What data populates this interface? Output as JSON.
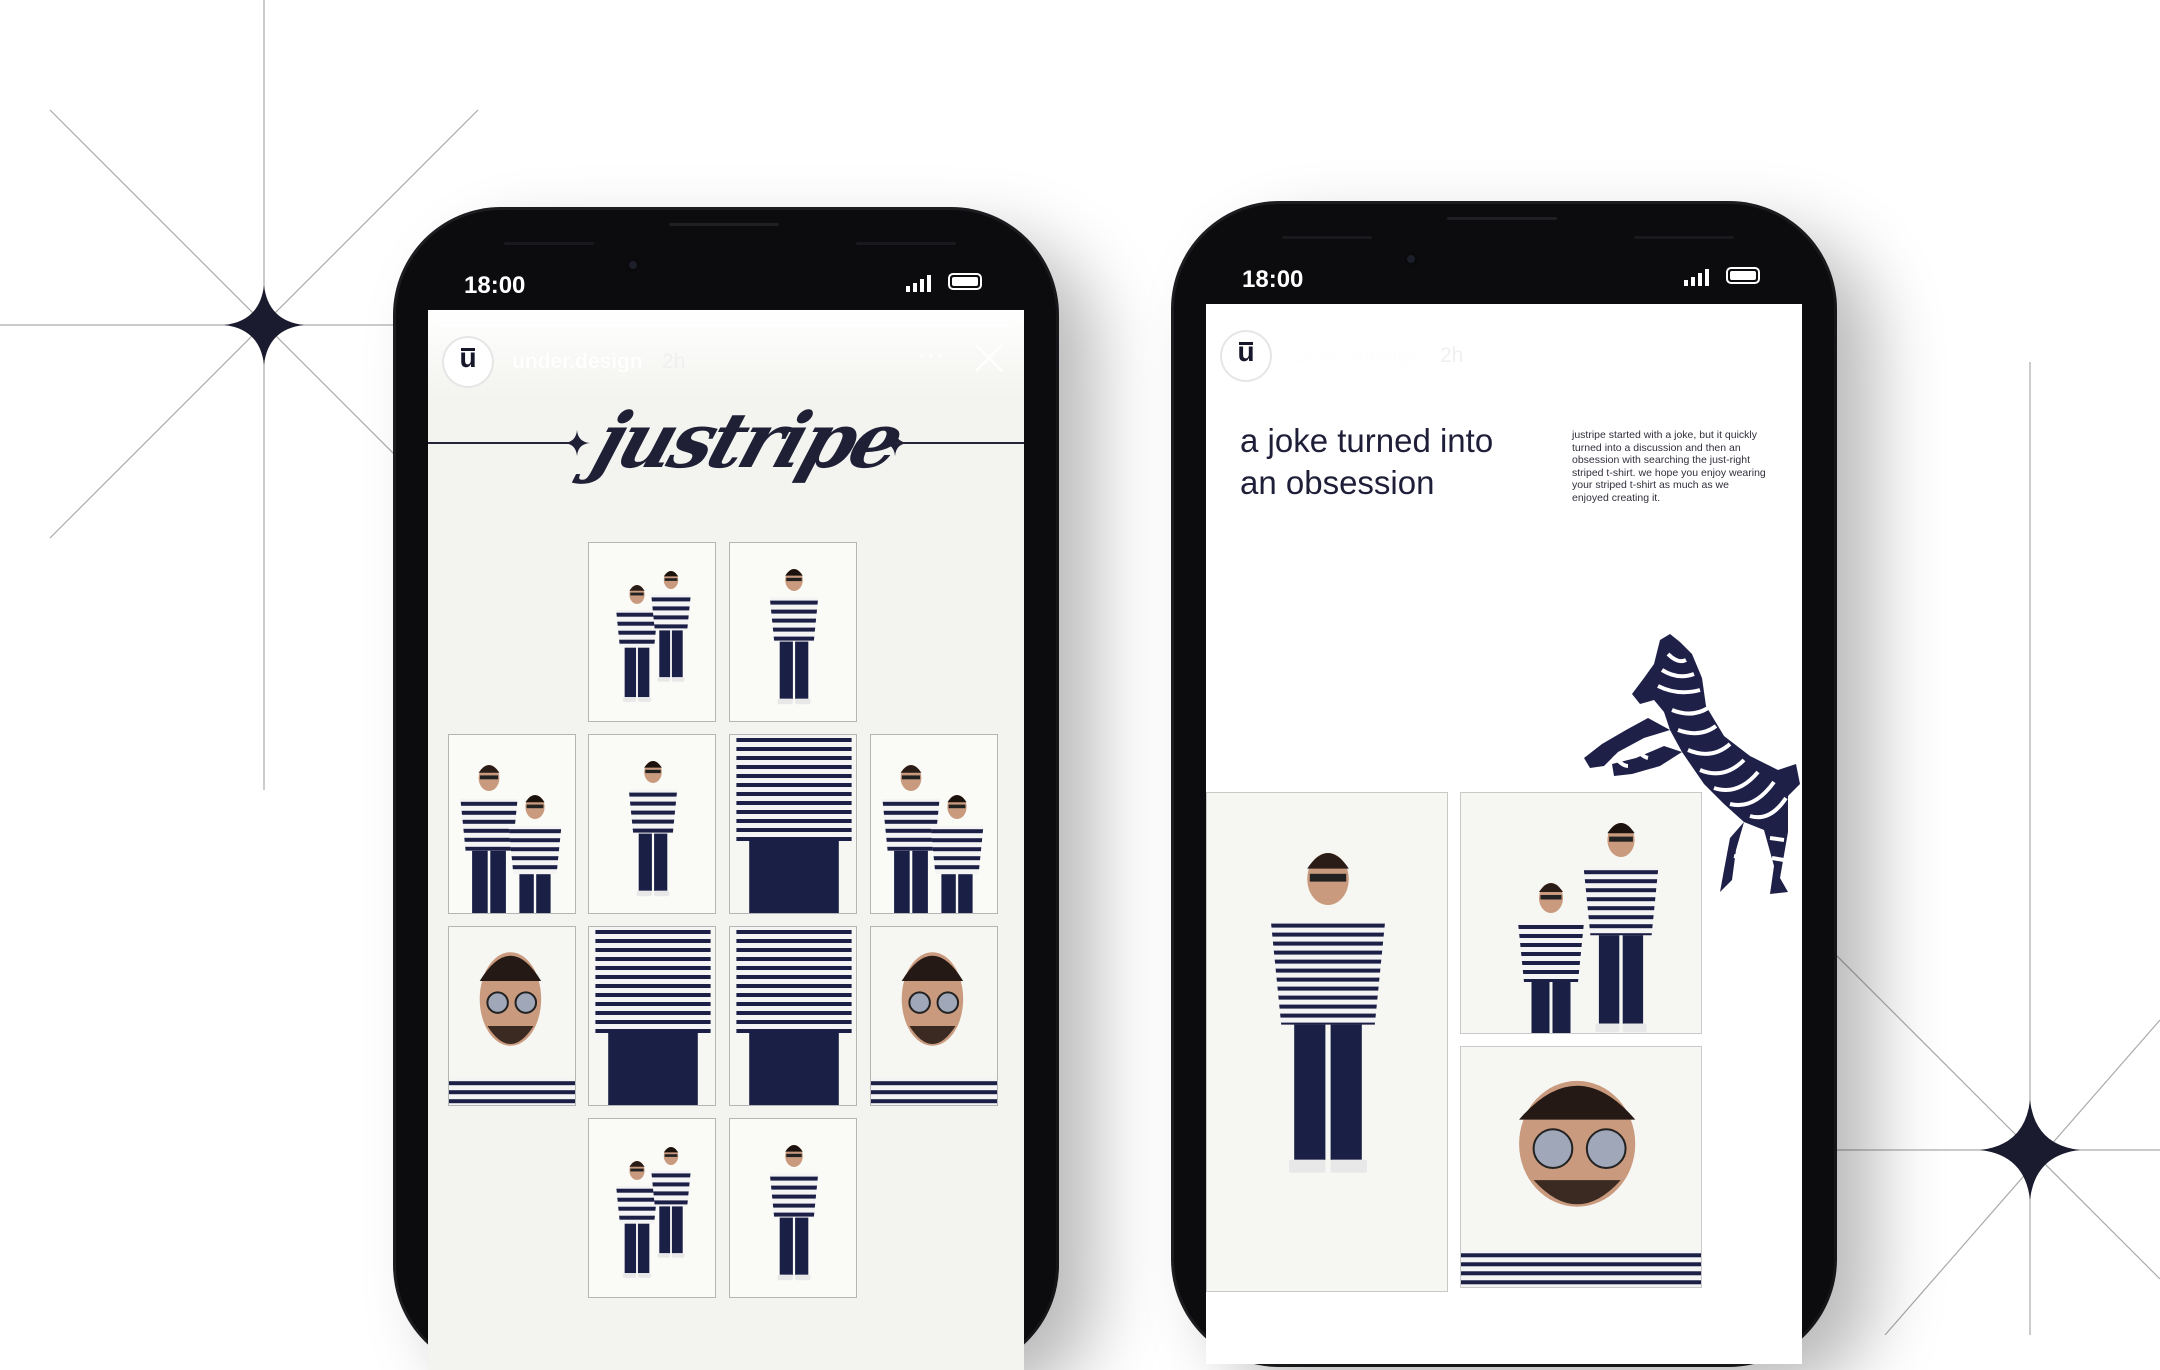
{
  "status_bar": {
    "time": "18:00"
  },
  "story": {
    "username": "under.design",
    "age": "2h",
    "avatar_letter": "ū",
    "more": "···"
  },
  "left_story": {
    "wordmark": "justripe"
  },
  "right_story": {
    "headline_line1": "a joke turned into",
    "headline_line2": "an obsession",
    "blurb": "justripe started with a joke, but it quickly turned into a discussion and then an obsession with searching the just-right striped t-shirt. we hope you enjoy wearing your striped t-shirt as much as we enjoyed creating it."
  },
  "colors": {
    "ink": "#1f1f36",
    "stripe_navy": "#1c1f46",
    "screen_bg": "#f3f4ef",
    "star": "#1b1b30"
  },
  "icons": [
    "signal-icon",
    "battery-icon",
    "close-icon",
    "more-icon",
    "sparkle-star-icon",
    "zebra-illustration"
  ]
}
